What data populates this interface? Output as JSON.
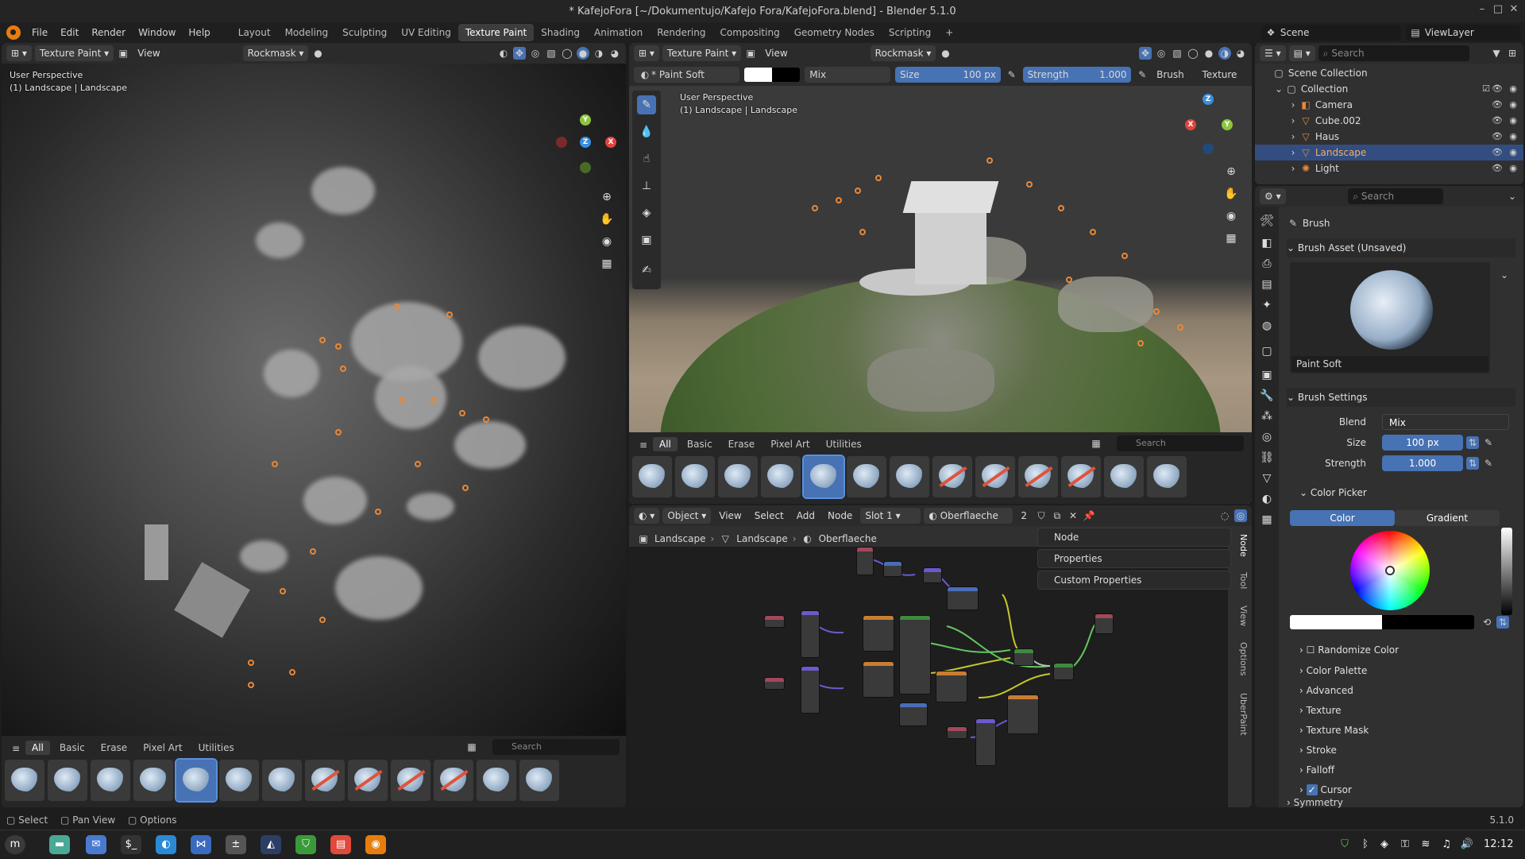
{
  "window": {
    "title": "* KafejoFora [~/Dokumentujo/Kafejo Fora/KafejoFora.blend] - Blender 5.1.0",
    "minimize": "–",
    "maximize": "□",
    "close": "✕"
  },
  "menu": {
    "items": [
      "File",
      "Edit",
      "Render",
      "Window",
      "Help"
    ],
    "workspaces": [
      "Layout",
      "Modeling",
      "Sculpting",
      "UV Editing",
      "Texture Paint",
      "Shading",
      "Animation",
      "Rendering",
      "Compositing",
      "Geometry Nodes",
      "Scripting"
    ],
    "active_workspace": "Texture Paint",
    "add": "+"
  },
  "scene_selector": {
    "scene": "Scene",
    "view_layer": "ViewLayer"
  },
  "left_viewport": {
    "mode": "Texture Paint",
    "view": "View",
    "mask": "Rockmask",
    "perspective": "User Perspective",
    "object": "(1) Landscape | Landscape",
    "shelf": {
      "tabs": [
        "All",
        "Basic",
        "Erase",
        "Pixel Art",
        "Utilities"
      ],
      "active": "All",
      "search_placeholder": "Search"
    }
  },
  "right_viewport": {
    "mode": "Texture Paint",
    "view": "View",
    "mask": "Rockmask",
    "brush": "* Paint Soft",
    "blend": "Mix",
    "size_label": "Size",
    "size_value": "100 px",
    "strength_label": "Strength",
    "strength_value": "1.000",
    "brush_menu": "Brush",
    "texture_menu": "Texture",
    "perspective": "User Perspective",
    "object": "(1) Landscape | Landscape",
    "shelf": {
      "tabs": [
        "All",
        "Basic",
        "Erase",
        "Pixel Art",
        "Utilities"
      ],
      "active": "All",
      "search_placeholder": "Search"
    }
  },
  "shader_editor": {
    "object_mode": "Object",
    "menus": [
      "View",
      "Select",
      "Add",
      "Node"
    ],
    "slot": "Slot 1",
    "material": "Oberflaeche",
    "users": "2",
    "breadcrumb": [
      "Landscape",
      "Landscape",
      "Oberflaeche"
    ],
    "panels": [
      "Node",
      "Properties",
      "Custom Properties"
    ],
    "side_tabs": [
      "Node",
      "Tool",
      "View",
      "Options",
      "UberPaint"
    ]
  },
  "outliner": {
    "search_placeholder": "Search",
    "root": "Scene Collection",
    "collection": "Collection",
    "items": [
      "Camera",
      "Cube.002",
      "Haus",
      "Landscape",
      "Light"
    ],
    "selected": "Landscape"
  },
  "properties": {
    "search_placeholder": "Search",
    "title": "Brush",
    "asset_section": "Brush Asset (Unsaved)",
    "asset_name": "Paint Soft",
    "settings_section": "Brush Settings",
    "blend_label": "Blend",
    "blend_value": "Mix",
    "size_label": "Size",
    "size_value": "100 px",
    "strength_label": "Strength",
    "strength_value": "1.000",
    "color_picker": "Color Picker",
    "color_tab": "Color",
    "gradient_tab": "Gradient",
    "subsections": [
      "Randomize Color",
      "Color Palette",
      "Advanced",
      "Texture",
      "Texture Mask",
      "Stroke",
      "Falloff",
      "Cursor",
      "Symmetry"
    ],
    "version": "5.1.0"
  },
  "statusbar": {
    "select": "Select",
    "pan": "Pan View",
    "options": "Options"
  },
  "taskbar": {
    "clock": "12:12"
  },
  "colors": {
    "accent": "#4772b3",
    "selection": "#334d80",
    "brand": "#e87d0d",
    "header": "#2b2b2b"
  }
}
